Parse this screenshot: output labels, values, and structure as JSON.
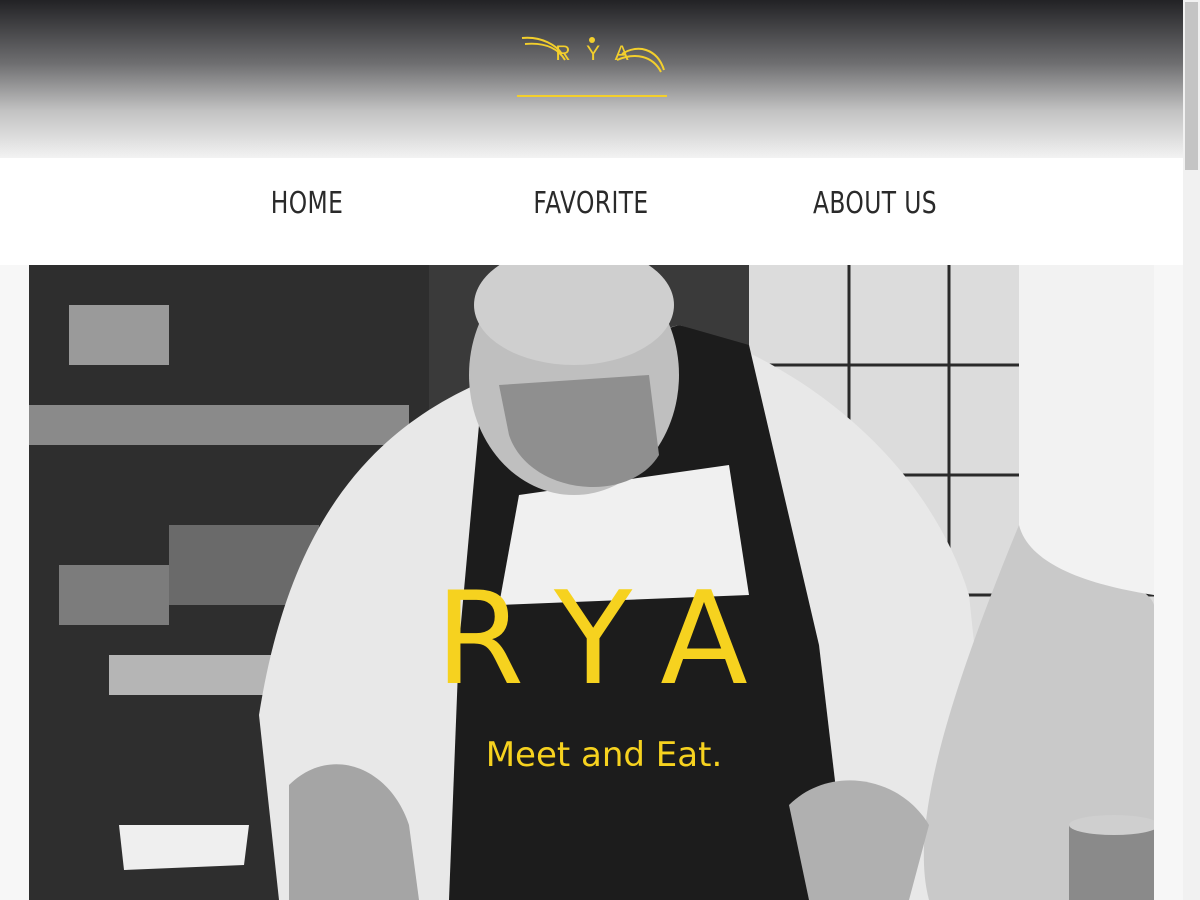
{
  "header": {
    "logo_text": "RYA"
  },
  "nav": {
    "items": [
      {
        "label": "HOME"
      },
      {
        "label": "FAVORITE"
      },
      {
        "label": "ABOUT US"
      }
    ]
  },
  "hero": {
    "title": "RYA",
    "tagline": "Meet and Eat."
  },
  "colors": {
    "accent": "#f6d21f",
    "nav_text": "#2a2a2a",
    "header_dark": "#222225"
  }
}
